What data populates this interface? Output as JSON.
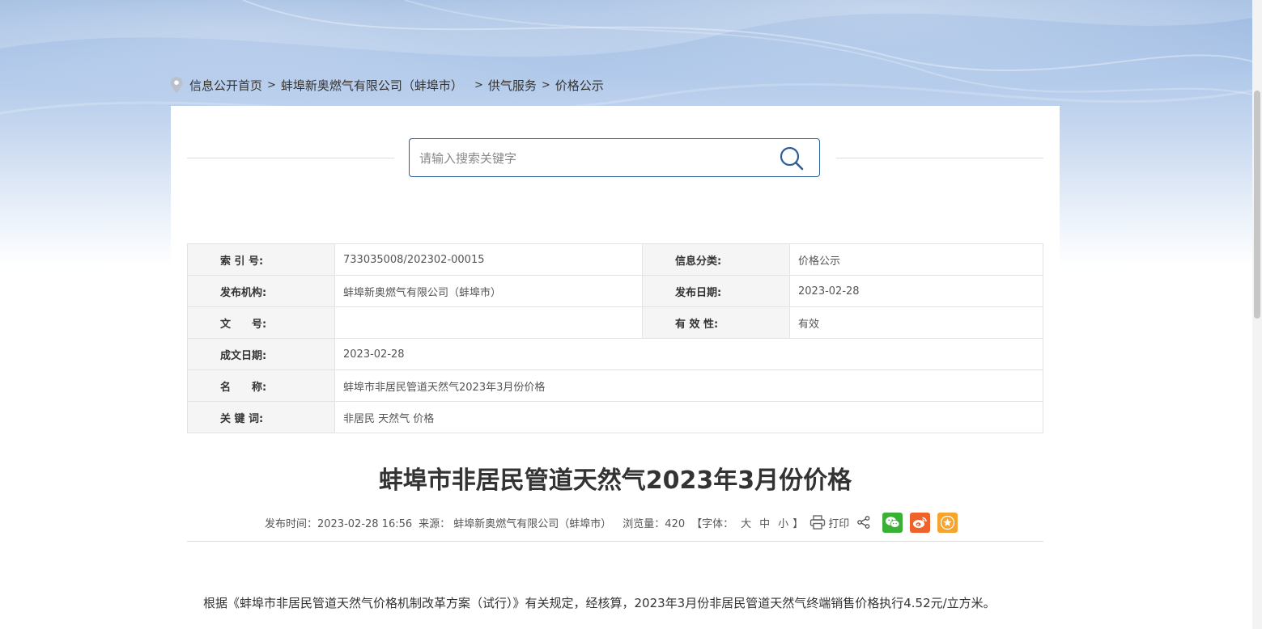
{
  "breadcrumb": {
    "items": [
      {
        "label": "信息公开首页"
      },
      {
        "label": "蚌埠新奥燃气有限公司（蚌埠市）"
      },
      {
        "label": "供气服务"
      },
      {
        "label": "价格公示"
      }
    ],
    "separator": ">"
  },
  "search": {
    "placeholder": "请输入搜索关键字",
    "value": ""
  },
  "meta": {
    "index_label": "索 引 号:",
    "index_value": "733035008/202302-00015",
    "category_label": "信息分类:",
    "category_value": "价格公示",
    "publisher_label": "发布机构:",
    "publisher_value": "蚌埠新奥燃气有限公司（蚌埠市）",
    "pub_date_label": "发布日期:",
    "pub_date_value": "2023-02-28",
    "doc_no_label": "文　　号:",
    "doc_no_value": "",
    "validity_label": "有 效 性:",
    "validity_value": "有效",
    "written_date_label": "成文日期:",
    "written_date_value": "2023-02-28",
    "name_label": "名　　称:",
    "name_value": "蚌埠市非居民管道天然气2023年3月份价格",
    "keywords_label": "关 键 词:",
    "keywords_value": "非居民 天然气 价格"
  },
  "article": {
    "title": "蚌埠市非居民管道天然气2023年3月份价格",
    "publish_time": "发布时间：2023-02-28 16:56",
    "source": "来源：  蚌埠新奥燃气有限公司（蚌埠市）",
    "views": "浏览量：420",
    "font_prefix": "【字体：",
    "font_large": "大",
    "font_medium": "中",
    "font_small": "小",
    "font_suffix": "】",
    "print": "打印",
    "body": "根据《蚌埠市非居民管道天然气价格机制改革方案（试行）》有关规定，经核算，2023年3月份非居民管道天然气终端销售价格执行4.52元/立方米。"
  },
  "colors": {
    "accent": "#2f5e9a",
    "wechat": "#3ab034",
    "weibo": "#f0622b",
    "favorite": "#f7a42f"
  },
  "icons": [
    "location-pin-icon",
    "search-icon",
    "printer-icon",
    "share-icon",
    "wechat-icon",
    "weibo-icon",
    "star-icon"
  ]
}
